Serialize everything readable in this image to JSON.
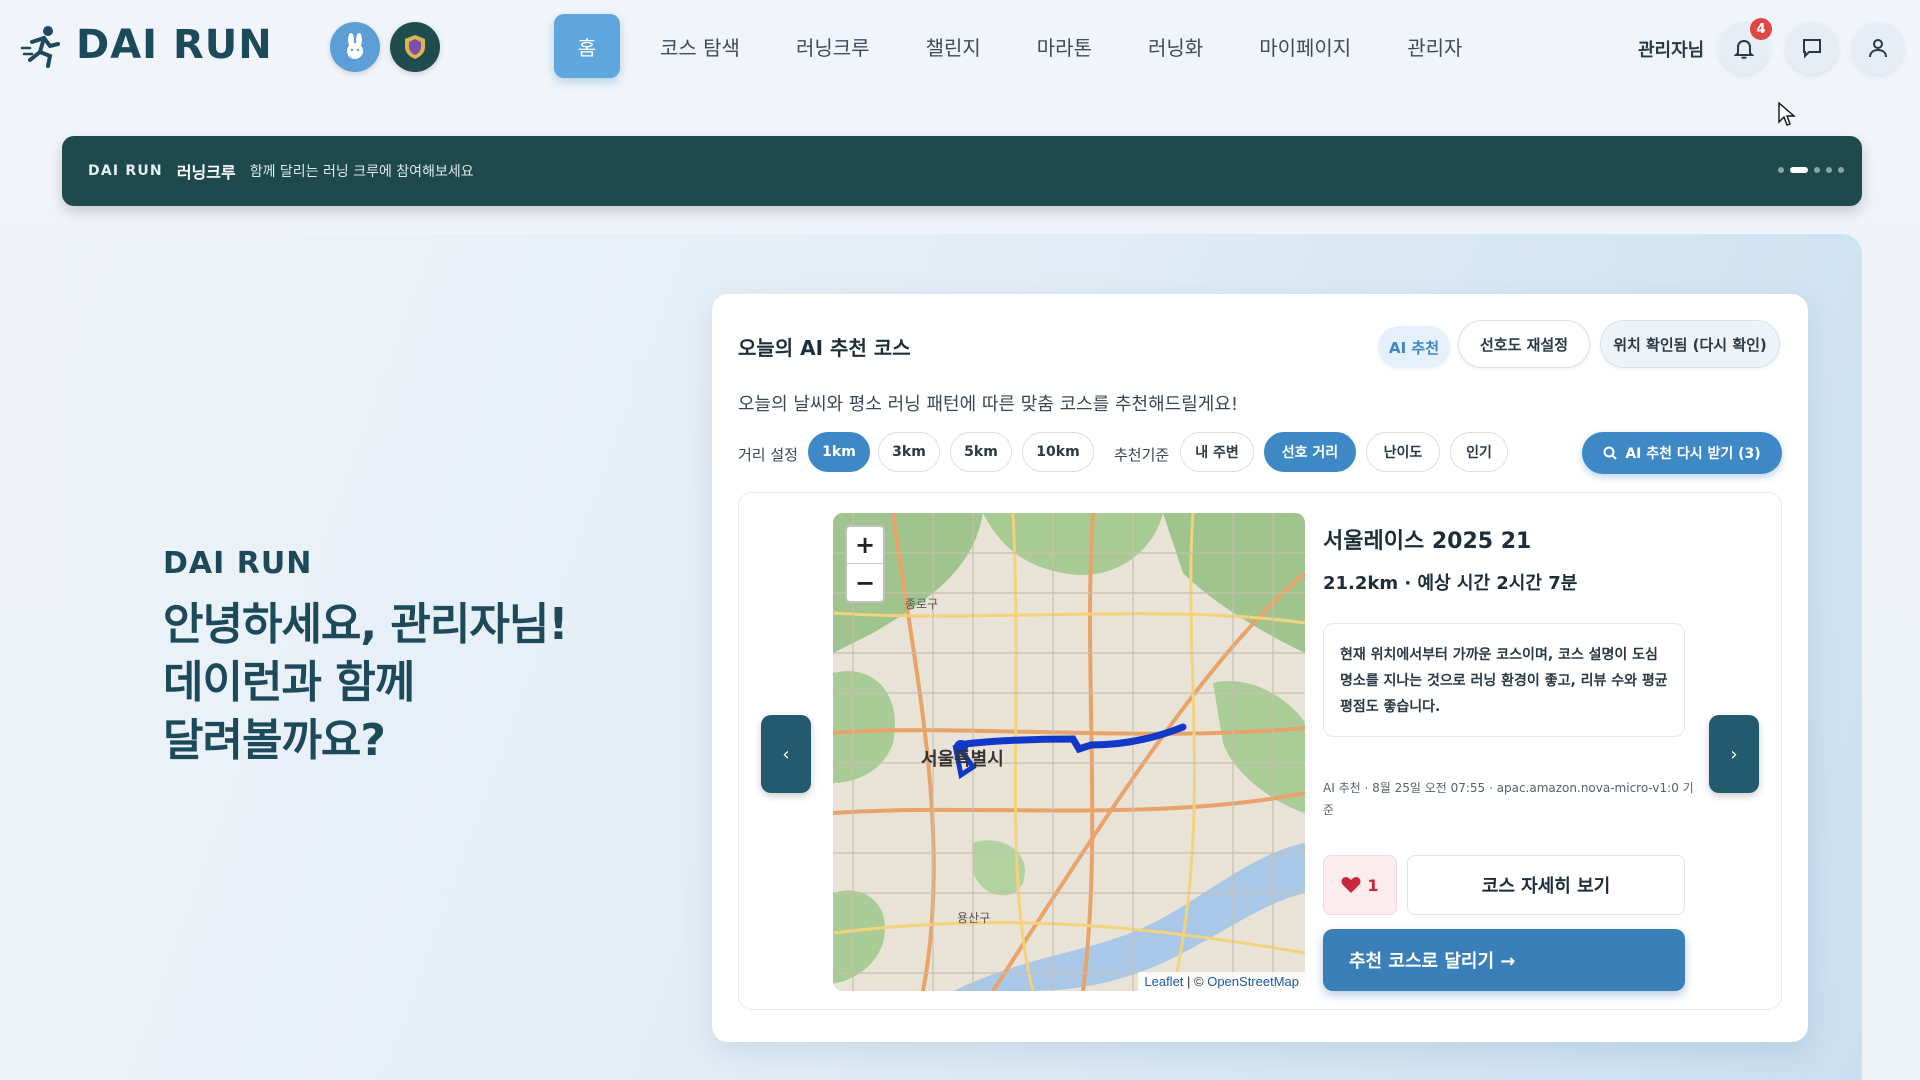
{
  "nav": {
    "brand": "DAI RUN",
    "links": [
      {
        "label": "홈"
      },
      {
        "label": "코스 탐색"
      },
      {
        "label": "러닝크루"
      },
      {
        "label": "챌린지"
      },
      {
        "label": "마라톤"
      },
      {
        "label": "러닝화"
      },
      {
        "label": "마이페이지"
      },
      {
        "label": "관리자"
      }
    ],
    "user_label": "관리자님",
    "notification_count": "4",
    "icons": [
      "runner-logo-icon",
      "rabbit-icon",
      "shield-icon",
      "bell-icon",
      "chat-icon",
      "user-icon"
    ]
  },
  "banner": {
    "brand": "DAI RUN",
    "title": "러닝크루",
    "subtitle": "함께 달리는 러닝 크루에 참여해보세요",
    "slide_count": 5,
    "active_slide": 2
  },
  "hero": {
    "brand": "DAI RUN",
    "greeting_lines": [
      "안녕하세요, 관리자님!",
      "데이런과 함께",
      "달려볼까요?"
    ]
  },
  "card": {
    "title": "오늘의 AI 추천 코스",
    "ai_badge": "AI 추천",
    "reset_label": "선호도 재설정",
    "location_label": "위치 확인됨 (다시 확인)",
    "description": "오늘의 날씨와 평소 러닝 패턴에 따른 맞춤 코스를 추천해드릴게요!",
    "distance_label": "거리 설정",
    "distances": [
      {
        "label": "1km",
        "selected": true
      },
      {
        "label": "3km",
        "selected": false
      },
      {
        "label": "5km",
        "selected": false
      },
      {
        "label": "10km",
        "selected": false
      }
    ],
    "criteria_label": "추천기준",
    "criteria": [
      {
        "label": "내 주변",
        "selected": false
      },
      {
        "label": "선호 거리",
        "selected": true
      },
      {
        "label": "난이도",
        "selected": false
      },
      {
        "label": "인기",
        "selected": false
      }
    ],
    "ai_again_label": "AI 추천 다시 받기 (3)",
    "prev_label": "‹",
    "next_label": "›",
    "course": {
      "name": "서울레이스 2025 21",
      "meta": "21.2km · 예상 시간 2시간 7분",
      "reason": "현재 위치에서부터 가까운 코스이며, 코스 설명이 도심 명소를 지나는 것으로 러닝 환경이 좋고, 리뷰 수와 평균 평점도 좋습니다.",
      "generated_info": "AI 추천 · 8월 25일 오전 07:55 · apac.amazon.nova-micro-v1:0 기준",
      "likes": "1",
      "detail_label": "코스 자세히 보기",
      "run_label": "추천 코스로 달리기 →"
    },
    "map": {
      "zoom_in": "+",
      "zoom_out": "−",
      "attribution_leaflet": "Leaflet",
      "attribution_sep": " | © ",
      "attribution_osm": "OpenStreetMap",
      "labels": {
        "center": "서울특별시",
        "north_district": "종로구",
        "south_district": "용산구"
      }
    }
  },
  "colors": {
    "brand": "#1c4a5a",
    "accent": "#3f88c6",
    "banner": "#1e4a4d",
    "route": "#1238c9",
    "like": "#c9283a"
  }
}
